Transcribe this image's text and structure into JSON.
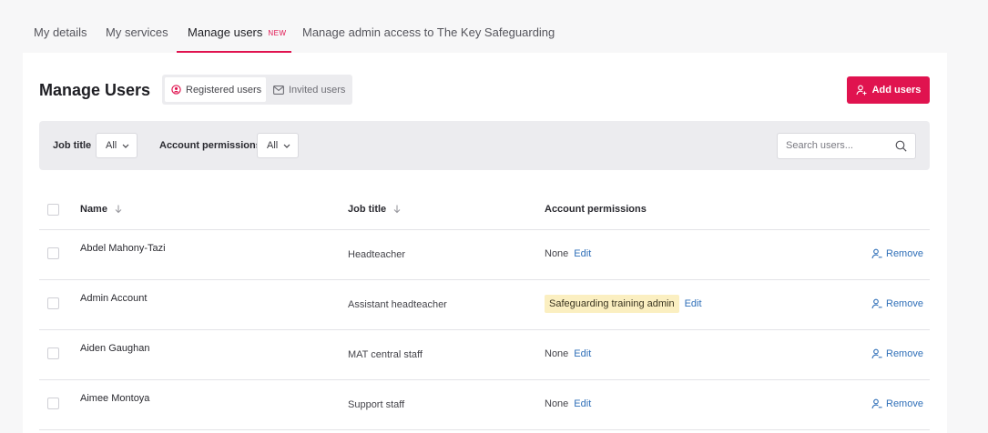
{
  "tabs": [
    {
      "label": "My details"
    },
    {
      "label": "My services"
    },
    {
      "label": "Manage users",
      "badge": "NEW"
    },
    {
      "label": "Manage admin access to The Key Safeguarding"
    }
  ],
  "page": {
    "title": "Manage Users",
    "toggle": {
      "registered": "Registered users",
      "invited": "Invited users"
    },
    "add_button": "Add users"
  },
  "filters": {
    "job_title_label": "Job title",
    "job_title_value": "All",
    "permissions_label": "Account permissions",
    "permissions_value": "All",
    "search_placeholder": "Search users..."
  },
  "table": {
    "headers": {
      "name": "Name",
      "job_title": "Job title",
      "permissions": "Account permissions"
    },
    "edit_label": "Edit",
    "remove_label": "Remove",
    "rows": [
      {
        "name": "Abdel Mahony-Tazi",
        "job_title": "Headteacher",
        "permission": "None",
        "permission_is_badge": false
      },
      {
        "name": "Admin Account",
        "job_title": "Assistant headteacher",
        "permission": "Safeguarding training admin",
        "permission_is_badge": true
      },
      {
        "name": "Aiden Gaughan",
        "job_title": "MAT central staff",
        "permission": "None",
        "permission_is_badge": false
      },
      {
        "name": "Aimee Montoya",
        "job_title": "Support staff",
        "permission": "None",
        "permission_is_badge": false
      }
    ]
  },
  "colors": {
    "accent": "#e0134f",
    "link": "#2f6fb8",
    "badge_bg": "#fbefc1"
  }
}
